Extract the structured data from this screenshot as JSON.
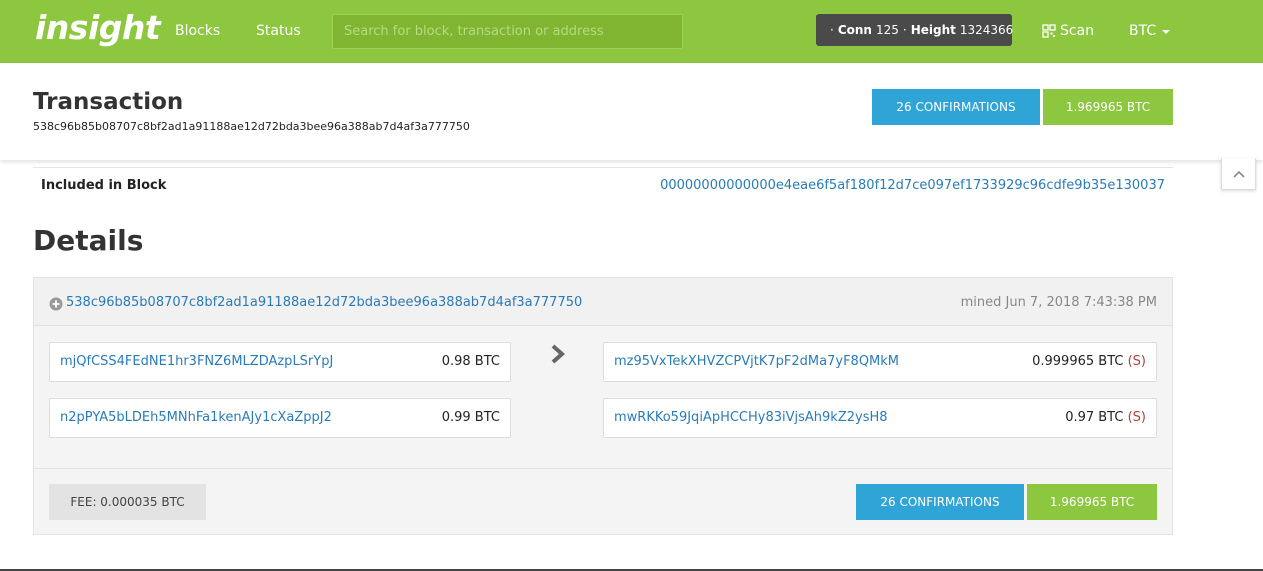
{
  "navbar": {
    "brand": "insight",
    "links": [
      "Blocks",
      "Status"
    ],
    "search_placeholder": "Search for block, transaction or address",
    "status": {
      "conn_label": "Conn",
      "conn_value": "125",
      "height_label": "Height",
      "height_value": "1324366"
    },
    "scan_label": "Scan",
    "currency_label": "BTC",
    "colors": {
      "bar": "#8dc63f",
      "status_badge": "#4a4a4a"
    }
  },
  "header": {
    "title": "Transaction",
    "txid": "538c96b85b08707c8bf2ad1a91188ae12d72bda3bee96a388ab7d4af3a777750",
    "confirmations_label": "26 CONFIRMATIONS",
    "amount_label": "1.969965 BTC"
  },
  "included_block": {
    "label": "Included in Block",
    "hash": "00000000000000e4eae6f5af180f12d7ce097ef1733929c96cdfe9b35e130037"
  },
  "details": {
    "title": "Details",
    "tx": {
      "txid": "538c96b85b08707c8bf2ad1a91188ae12d72bda3bee96a388ab7d4af3a777750",
      "mined": "mined Jun 7, 2018 7:43:38 PM",
      "inputs": [
        {
          "address": "mjQfCSS4FEdNE1hr3FNZ6MLZDAzpLSrYpJ",
          "value": "0.98 BTC"
        },
        {
          "address": "n2pPYA5bLDEh5MNhFa1kenAJy1cXaZppJ2",
          "value": "0.99 BTC"
        }
      ],
      "outputs": [
        {
          "address": "mz95VxTekXHVZCPVjtK7pF2dMa7yF8QMkM",
          "value": "0.999965 BTC",
          "spent": "(S)"
        },
        {
          "address": "mwRKKo59JqiApHCCHy83iVjsAh9kZ2ysH8",
          "value": "0.97 BTC",
          "spent": "(S)"
        }
      ],
      "fee": "FEE: 0.000035 BTC",
      "confirmations_label": "26 CONFIRMATIONS",
      "amount_label": "1.969965 BTC"
    }
  },
  "icons": [
    "check-icon",
    "scan-icon",
    "caret-down-icon",
    "chevron-up-icon",
    "plus-circle-icon",
    "chevron-right-icon"
  ],
  "colors": {
    "link": "#2b7bb9",
    "confirm": "#2fa4d7",
    "amount": "#8dc63f",
    "spent": "#a94442"
  }
}
